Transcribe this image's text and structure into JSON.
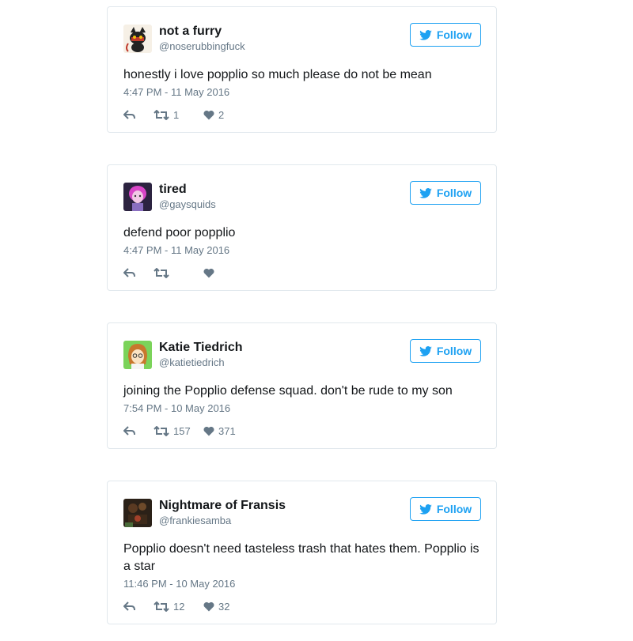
{
  "colors": {
    "accent": "#1da1f2",
    "text": "#14171a",
    "muted": "#657786",
    "border": "#e1e8ed"
  },
  "follow_label": "Follow",
  "tweets": [
    {
      "display_name": "not a furry",
      "handle": "@noserubbingfuck",
      "text": "honestly i love popplio so much please do not be mean",
      "timestamp": "4:47 PM - 11 May 2016",
      "retweets": "1",
      "likes": "2",
      "avatar_icon": "black-cat-avatar-icon"
    },
    {
      "display_name": "tired",
      "handle": "@gaysquids",
      "text": "defend poor popplio",
      "timestamp": "4:47 PM - 11 May 2016",
      "retweets": "",
      "likes": "",
      "avatar_icon": "pink-hair-character-avatar-icon"
    },
    {
      "display_name": "Katie Tiedrich",
      "handle": "@katietiedrich",
      "text": "joining the Popplio defense squad. don't be rude to my son",
      "timestamp": "7:54 PM - 10 May 2016",
      "retweets": "157",
      "likes": "371",
      "avatar_icon": "cartoon-person-avatar-icon"
    },
    {
      "display_name": "Nightmare of Fransis",
      "handle": "@frankiesamba",
      "text": "Popplio doesn't need tasteless trash that hates them. Popplio is a star",
      "timestamp": "11:46 PM - 10 May 2016",
      "retweets": "12",
      "likes": "32",
      "avatar_icon": "dark-photo-avatar-icon"
    }
  ]
}
